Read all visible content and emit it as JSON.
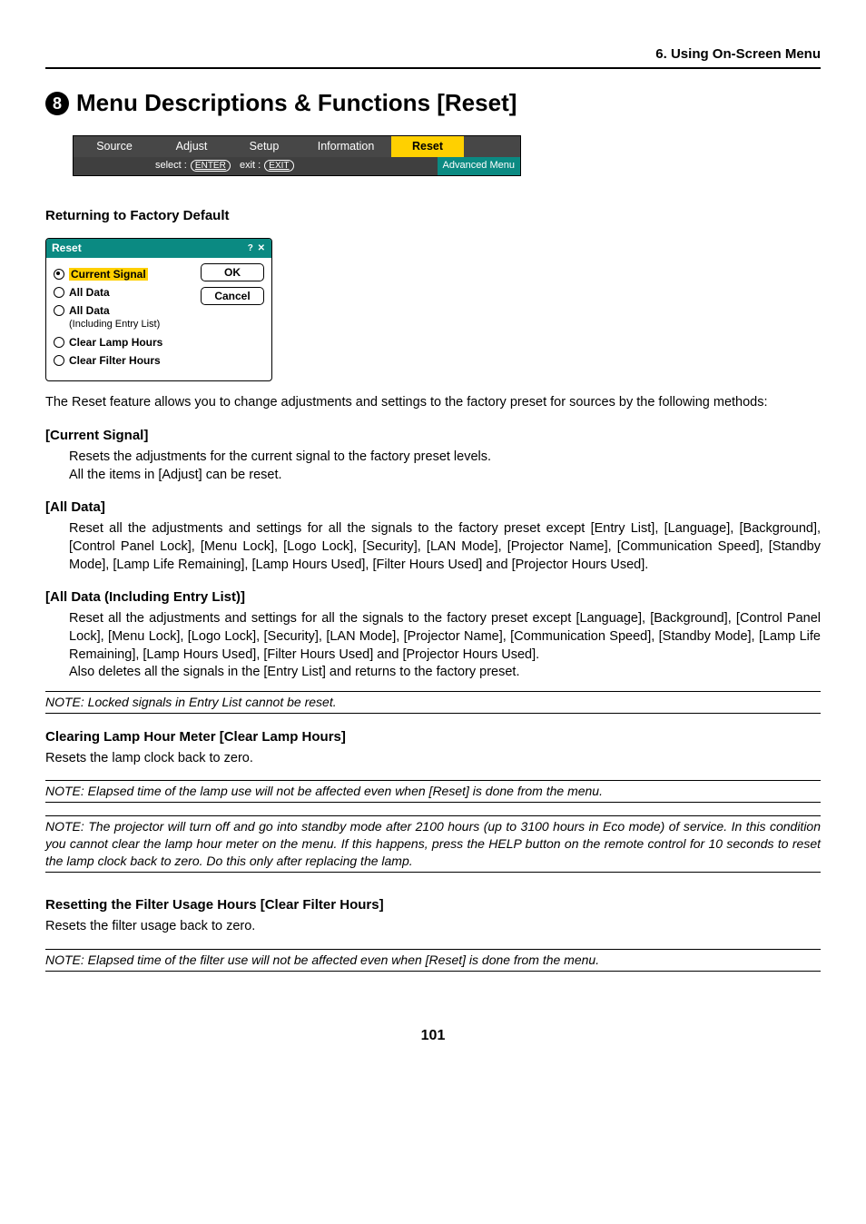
{
  "chapter": "6. Using On-Screen Menu",
  "circled_number": "8",
  "main_title": "Menu Descriptions & Functions [Reset]",
  "menubar": {
    "items": [
      "Source",
      "Adjust",
      "Setup",
      "Information",
      "Reset"
    ],
    "hint_select": "select :",
    "hint_enter": "ENTER",
    "hint_exit_label": "exit :",
    "hint_exit": "EXIT",
    "advanced": "Advanced Menu"
  },
  "section1_title": "Returning to Factory Default",
  "reset_dialog": {
    "title": "Reset",
    "options": [
      {
        "label": "Current Signal",
        "selected": true
      },
      {
        "label": "All Data",
        "selected": false
      },
      {
        "label": "All Data",
        "sub": "(Including Entry List)",
        "selected": false
      },
      {
        "label": "Clear Lamp Hours",
        "selected": false
      },
      {
        "label": "Clear Filter Hours",
        "selected": false
      }
    ],
    "ok": "OK",
    "cancel": "Cancel"
  },
  "intro_para": "The Reset feature allows you to change adjustments and settings to the factory preset for sources by the following methods:",
  "cs_head": "[Current Signal]",
  "cs_body1": "Resets the adjustments for the current signal to the factory preset levels.",
  "cs_body2": "All the items in [Adjust] can be reset.",
  "ad_head": "[All Data]",
  "ad_body": "Reset all the adjustments and settings for all the signals to the factory preset except [Entry List], [Language], [Background], [Control Panel Lock], [Menu Lock], [Logo Lock], [Security], [LAN Mode], [Projector Name], [Communication Speed], [Standby Mode], [Lamp Life Remaining], [Lamp Hours Used], [Filter Hours Used] and [Projector Hours Used].",
  "adel_head": "[All Data (Including Entry List)]",
  "adel_body1": "Reset all the adjustments and settings for all the signals to the factory preset except [Language], [Background], [Control Panel Lock], [Menu Lock], [Logo Lock], [Security], [LAN Mode], [Projector Name], [Communication Speed], [Standby Mode], [Lamp Life Remaining], [Lamp Hours Used], [Filter Hours Used] and [Projector Hours Used].",
  "adel_body2": "Also deletes all the signals in the [Entry List] and returns to the factory preset.",
  "note1": "NOTE: Locked signals in Entry List cannot be reset.",
  "clh_head": "Clearing Lamp Hour Meter [Clear Lamp Hours]",
  "clh_body": "Resets the lamp clock back to zero.",
  "note2": "NOTE: Elapsed time of the lamp use will not be affected even when [Reset] is done from the menu.",
  "note3": "NOTE: The projector will turn off and go into standby mode after 2100 hours (up to 3100 hours in Eco mode) of service. In this condition you cannot clear the lamp hour meter on the menu. If this happens, press the HELP button on the remote control for 10 seconds to reset the lamp clock back to zero. Do this only after replacing the lamp.",
  "cfh_head": "Resetting the Filter Usage Hours [Clear Filter Hours]",
  "cfh_body": "Resets the filter usage back to zero.",
  "note4": "NOTE: Elapsed time of the filter use will not be affected even when [Reset] is done from the menu.",
  "page_number": "101"
}
